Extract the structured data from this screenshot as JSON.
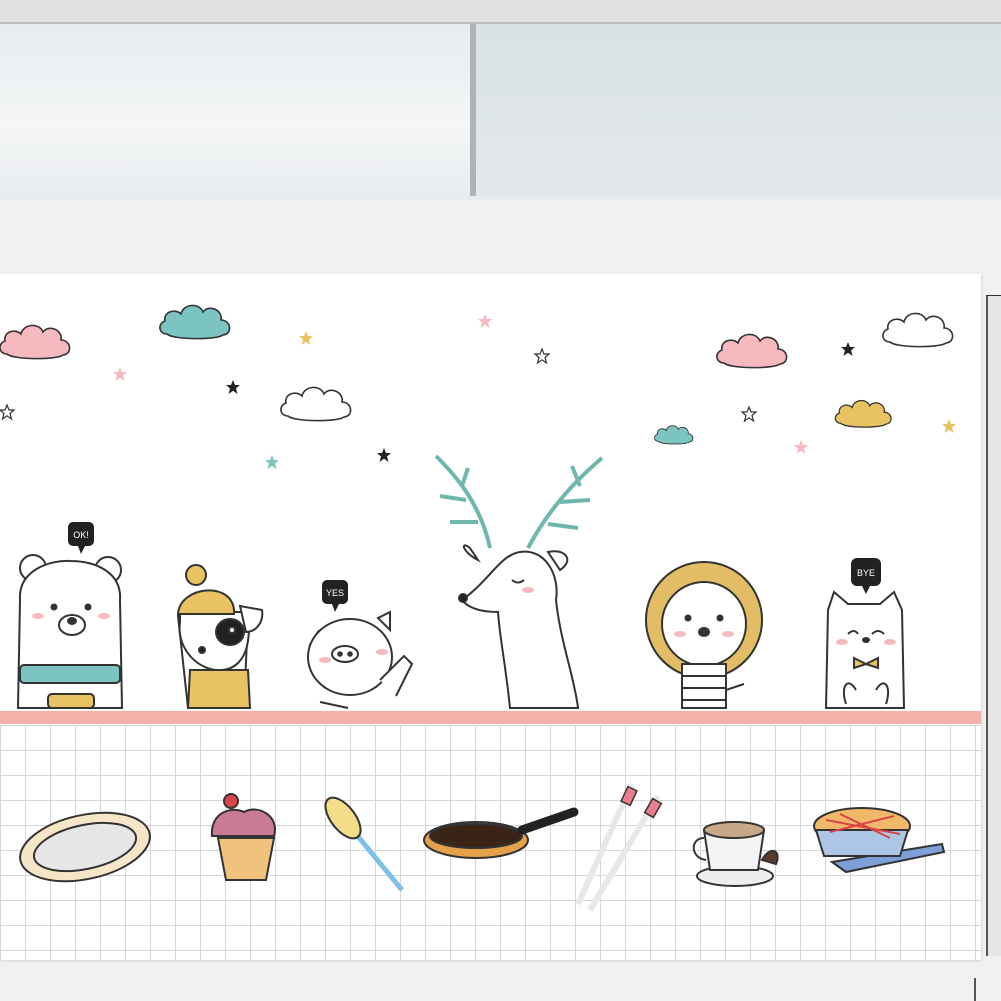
{
  "speech_bubbles": {
    "bear": "OK!",
    "pig": "YES",
    "cat": "BYE"
  },
  "colors": {
    "shelf": "#f3b1a9",
    "cloud_pink": "#f6b9bf",
    "cloud_teal": "#7cc4c2",
    "cloud_yellow": "#e9c262",
    "antler": "#6fb7ac"
  }
}
